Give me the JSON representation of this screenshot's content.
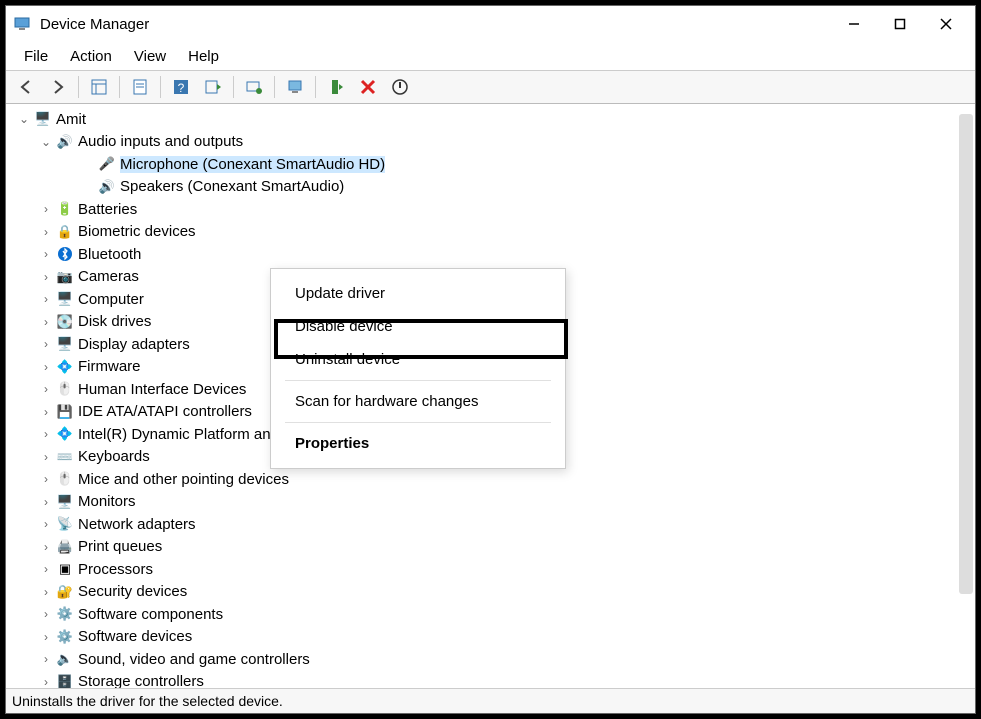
{
  "title": "Device Manager",
  "menubar": [
    "File",
    "Action",
    "View",
    "Help"
  ],
  "context_menu": {
    "items": [
      {
        "label": "Update driver",
        "bold": false,
        "sep": false
      },
      {
        "label": "Disable device",
        "bold": false,
        "sep": false
      },
      {
        "label": "Uninstall device",
        "bold": false,
        "sep": true
      },
      {
        "label": "Scan for hardware changes",
        "bold": false,
        "sep": true
      },
      {
        "label": "Properties",
        "bold": true,
        "sep": false
      }
    ],
    "highlighted_index": 2
  },
  "tree": {
    "root": {
      "label": "Amit",
      "expanded": true,
      "icon": "computer"
    },
    "nodes": [
      {
        "label": "Audio inputs and outputs",
        "icon": "speaker",
        "expanded": true,
        "children": [
          {
            "label": "Microphone (Conexant SmartAudio HD)",
            "icon": "mic",
            "selected": true
          },
          {
            "label": "Speakers (Conexant SmartAudio)",
            "icon": "speaker"
          }
        ]
      },
      {
        "label": "Batteries",
        "icon": "battery"
      },
      {
        "label": "Biometric devices",
        "icon": "fingerprint"
      },
      {
        "label": "Bluetooth",
        "icon": "bluetooth"
      },
      {
        "label": "Cameras",
        "icon": "camera"
      },
      {
        "label": "Computer",
        "icon": "computer"
      },
      {
        "label": "Disk drives",
        "icon": "disk"
      },
      {
        "label": "Display adapters",
        "icon": "display"
      },
      {
        "label": "Firmware",
        "icon": "chip"
      },
      {
        "label": "Human Interface Devices",
        "icon": "hid"
      },
      {
        "label": "IDE ATA/ATAPI controllers",
        "icon": "ide"
      },
      {
        "label": "Intel(R) Dynamic Platform and Thermal Framework",
        "icon": "chip"
      },
      {
        "label": "Keyboards",
        "icon": "keyboard"
      },
      {
        "label": "Mice and other pointing devices",
        "icon": "mouse"
      },
      {
        "label": "Monitors",
        "icon": "monitor"
      },
      {
        "label": "Network adapters",
        "icon": "network"
      },
      {
        "label": "Print queues",
        "icon": "printer"
      },
      {
        "label": "Processors",
        "icon": "cpu"
      },
      {
        "label": "Security devices",
        "icon": "security"
      },
      {
        "label": "Software components",
        "icon": "sw"
      },
      {
        "label": "Software devices",
        "icon": "sw"
      },
      {
        "label": "Sound, video and game controllers",
        "icon": "sound"
      },
      {
        "label": "Storage controllers",
        "icon": "storage"
      }
    ]
  },
  "statusbar": "Uninstalls the driver for the selected device.",
  "icons": {
    "computer": "🖥️",
    "speaker": "🔊",
    "mic": "🎤",
    "battery": "🔋",
    "fingerprint": "🔒",
    "bluetooth": "",
    "camera": "📷",
    "disk": "💽",
    "display": "🖥️",
    "chip": "💠",
    "hid": "🖱️",
    "ide": "💾",
    "keyboard": "⌨️",
    "mouse": "🖱️",
    "monitor": "🖥️",
    "network": "📡",
    "printer": "🖨️",
    "cpu": "▣",
    "security": "🔐",
    "sw": "⚙️",
    "sound": "🔈",
    "storage": "🗄️"
  }
}
